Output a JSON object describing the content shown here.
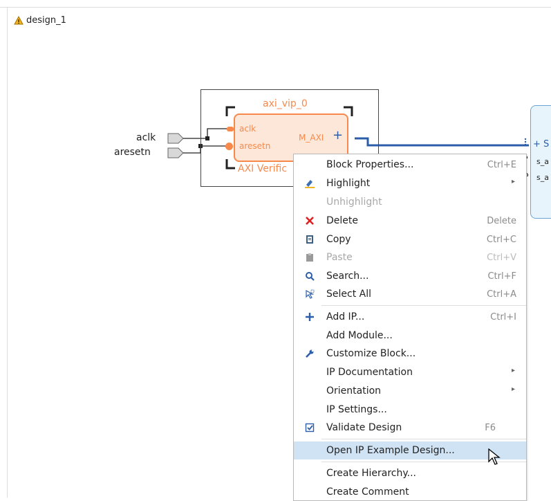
{
  "tab": {
    "title": "design_1",
    "icon": "warning-hierarchy-icon"
  },
  "ports": {
    "aclk": "aclk",
    "aresetn": "aresetn"
  },
  "ip_block": {
    "instance_name": "axi_vip_0",
    "pin_aclk": "aclk",
    "pin_aresetn": "aresetn",
    "pin_maxi": "M_AXI",
    "subtitle": "AXI Verific"
  },
  "right_block": {
    "plus": "+ S",
    "pin1": "s_a",
    "pin2": "s_a"
  },
  "colors": {
    "ip_orange": "#f7894a",
    "wire_blue": "#2c5da8",
    "selection": "#cfe3f5"
  },
  "menu": {
    "items": [
      {
        "label": "Block Properties...",
        "shortcut": "Ctrl+E",
        "icon": ""
      },
      {
        "label": "Highlight",
        "submenu": true,
        "icon": "highlight-icon"
      },
      {
        "label": "Unhighlight",
        "disabled": true,
        "icon": ""
      },
      {
        "label": "Delete",
        "shortcut": "Delete",
        "icon": "delete-icon"
      },
      {
        "label": "Copy",
        "shortcut": "Ctrl+C",
        "icon": "copy-icon"
      },
      {
        "label": "Paste",
        "shortcut": "Ctrl+V",
        "disabled": true,
        "icon": "paste-icon"
      },
      {
        "label": "Search...",
        "shortcut": "Ctrl+F",
        "icon": "search-icon"
      },
      {
        "label": "Select All",
        "shortcut": "Ctrl+A",
        "icon": "select-all-icon"
      },
      {
        "label": "Add IP...",
        "shortcut": "Ctrl+I",
        "icon": "add-icon"
      },
      {
        "label": "Add Module...",
        "icon": ""
      },
      {
        "label": "Customize Block...",
        "icon": "wrench-icon"
      },
      {
        "label": "IP Documentation",
        "submenu": true,
        "icon": ""
      },
      {
        "label": "Orientation",
        "submenu": true,
        "icon": ""
      },
      {
        "label": "IP Settings...",
        "icon": ""
      },
      {
        "label": "Validate Design",
        "shortcut": "F6",
        "icon": "validate-icon"
      },
      {
        "label": "Open IP Example Design...",
        "selected": true,
        "icon": ""
      },
      {
        "label": "Create Hierarchy...",
        "icon": ""
      },
      {
        "label": "Create Comment",
        "icon": ""
      }
    ]
  }
}
